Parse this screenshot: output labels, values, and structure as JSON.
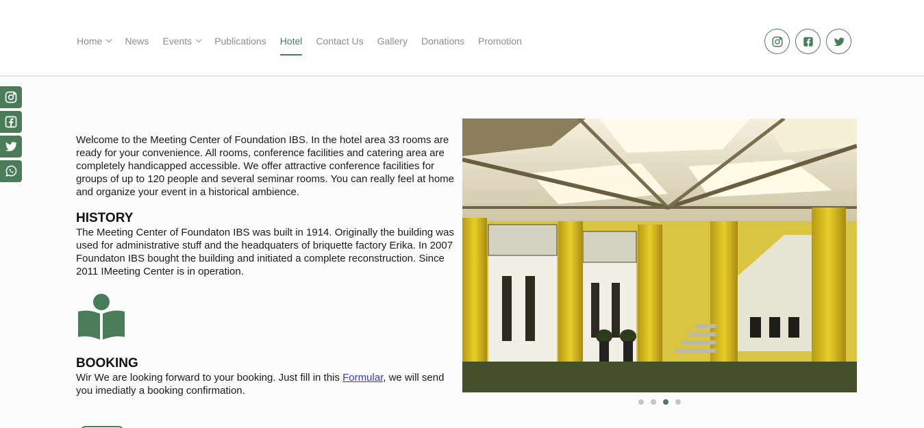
{
  "nav": {
    "items": [
      {
        "label": "Home",
        "dropdown": true
      },
      {
        "label": "News",
        "dropdown": false
      },
      {
        "label": "Events",
        "dropdown": true
      },
      {
        "label": "Publications",
        "dropdown": false
      },
      {
        "label": "Hotel",
        "dropdown": false,
        "active": true
      },
      {
        "label": "Contact Us",
        "dropdown": false
      },
      {
        "label": "Gallery",
        "dropdown": false
      },
      {
        "label": "Donations",
        "dropdown": false
      },
      {
        "label": "Promotion",
        "dropdown": false
      }
    ]
  },
  "header_social": [
    "instagram-icon",
    "facebook-icon",
    "twitter-icon"
  ],
  "side_social": [
    "instagram-icon",
    "facebook-icon",
    "twitter-icon",
    "whatsapp-icon"
  ],
  "content": {
    "intro": "Welcome to the Meeting Center of Foundation IBS. In the hotel area 33 rooms are ready for your convenience. All rooms, conference facilities and catering area are completely handicapped accessible. We offer attractive conference facilities for groups of up to 120 people and several seminar rooms. You can really feel at home and organize your event in a historical ambience.",
    "history_title": "HISTORY",
    "history_text": "The Meeting Center of Foundaton IBS was built in 1914. Originally the building was used for administrative stuff and the headquaters of briquette factory Erika. In 2007 Foundaton IBS bought the building and initiated a complete reconstruction. Since 2011 IMeeting Center is in operation.",
    "booking_title": "BOOKING",
    "booking_text_before": "Wir We are looking forward to your booking. Just fill in this ",
    "booking_link": "Formular",
    "booking_text_after": ", we will send you imediatly a booking confirmation."
  },
  "slider": {
    "slide_count": 4,
    "active_slide": 3
  },
  "colors": {
    "accent": "#4a7c59",
    "nav_text": "#8c8c8c",
    "link": "#3a3ab8"
  }
}
